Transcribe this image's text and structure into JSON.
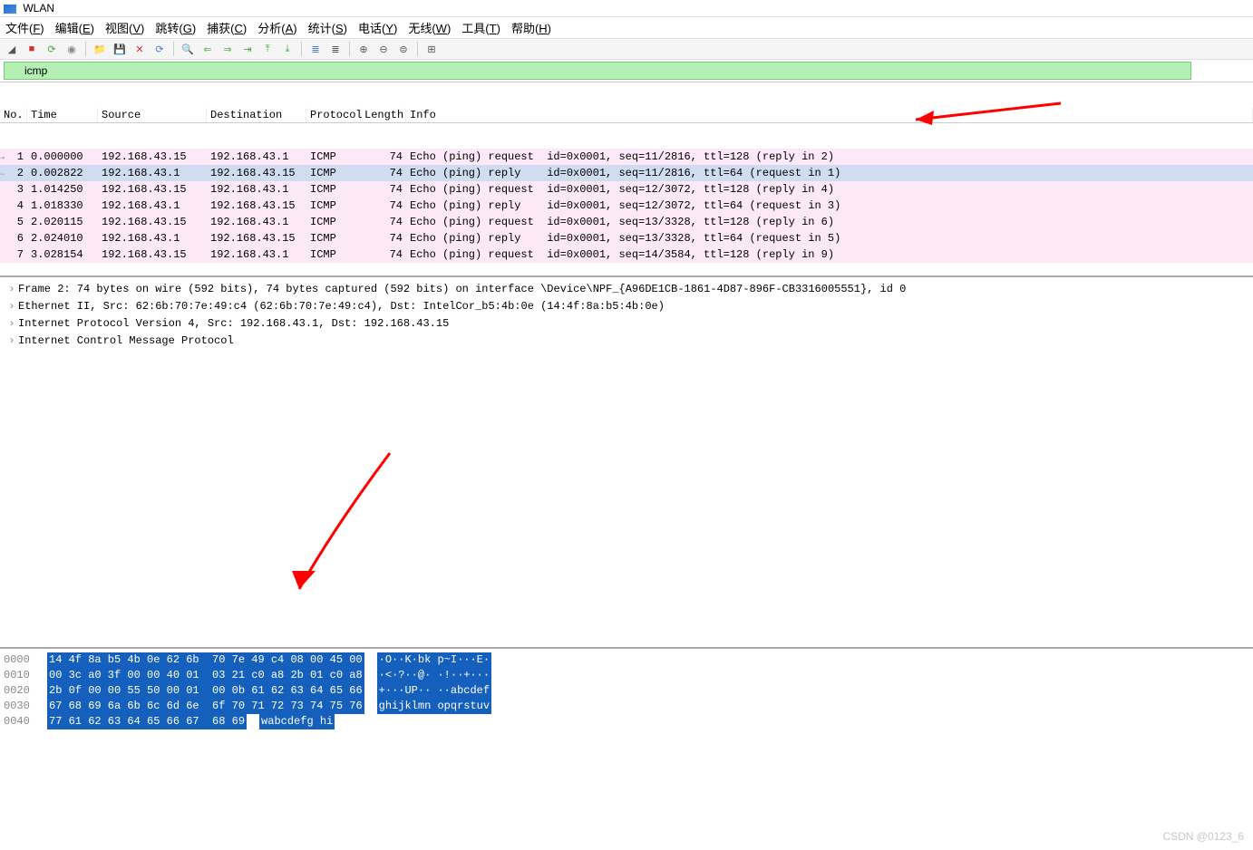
{
  "window_title": "WLAN",
  "menu": [
    "文件(F)",
    "编辑(E)",
    "视图(V)",
    "跳转(G)",
    "捕获(C)",
    "分析(A)",
    "统计(S)",
    "电话(Y)",
    "无线(W)",
    "工具(T)",
    "帮助(H)"
  ],
  "filter_value": "icmp",
  "columns": {
    "no": "No.",
    "time": "Time",
    "src": "Source",
    "dst": "Destination",
    "proto": "Protocol",
    "len": "Length",
    "info": "Info"
  },
  "packets": [
    {
      "no": "1",
      "time": "0.000000",
      "src": "192.168.43.15",
      "dst": "192.168.43.1",
      "proto": "ICMP",
      "len": "74",
      "info": "Echo (ping) request  id=0x0001, seq=11/2816, ttl=128 (reply in 2)",
      "cls": "pink",
      "arrow": "→"
    },
    {
      "no": "2",
      "time": "0.002822",
      "src": "192.168.43.1",
      "dst": "192.168.43.15",
      "proto": "ICMP",
      "len": "74",
      "info": "Echo (ping) reply    id=0x0001, seq=11/2816, ttl=64 (request in 1)",
      "cls": "blue-sel",
      "arrow": "←"
    },
    {
      "no": "3",
      "time": "1.014250",
      "src": "192.168.43.15",
      "dst": "192.168.43.1",
      "proto": "ICMP",
      "len": "74",
      "info": "Echo (ping) request  id=0x0001, seq=12/3072, ttl=128 (reply in 4)",
      "cls": "pink",
      "arrow": ""
    },
    {
      "no": "4",
      "time": "1.018330",
      "src": "192.168.43.1",
      "dst": "192.168.43.15",
      "proto": "ICMP",
      "len": "74",
      "info": "Echo (ping) reply    id=0x0001, seq=12/3072, ttl=64 (request in 3)",
      "cls": "pink",
      "arrow": ""
    },
    {
      "no": "5",
      "time": "2.020115",
      "src": "192.168.43.15",
      "dst": "192.168.43.1",
      "proto": "ICMP",
      "len": "74",
      "info": "Echo (ping) request  id=0x0001, seq=13/3328, ttl=128 (reply in 6)",
      "cls": "pink",
      "arrow": ""
    },
    {
      "no": "6",
      "time": "2.024010",
      "src": "192.168.43.1",
      "dst": "192.168.43.15",
      "proto": "ICMP",
      "len": "74",
      "info": "Echo (ping) reply    id=0x0001, seq=13/3328, ttl=64 (request in 5)",
      "cls": "pink",
      "arrow": ""
    },
    {
      "no": "7",
      "time": "3.028154",
      "src": "192.168.43.15",
      "dst": "192.168.43.1",
      "proto": "ICMP",
      "len": "74",
      "info": "Echo (ping) request  id=0x0001, seq=14/3584, ttl=128 (reply in 9)",
      "cls": "pink",
      "arrow": ""
    }
  ],
  "tree": [
    "Frame 2: 74 bytes on wire (592 bits), 74 bytes captured (592 bits) on interface \\Device\\NPF_{A96DE1CB-1861-4D87-896F-CB3316005551}, id 0",
    "Ethernet II, Src: 62:6b:70:7e:49:c4 (62:6b:70:7e:49:c4), Dst: IntelCor_b5:4b:0e (14:4f:8a:b5:4b:0e)",
    "Internet Protocol Version 4, Src: 192.168.43.1, Dst: 192.168.43.15",
    "Internet Control Message Protocol"
  ],
  "hex": [
    {
      "off": "0000",
      "b1": "14 4f 8a b5 4b 0e 62 6b",
      "b2": "70 7e 49 c4 08 00 45 00",
      "asc": "·O··K·bk p~I···E·"
    },
    {
      "off": "0010",
      "b1": "00 3c a0 3f 00 00 40 01",
      "b2": "03 21 c0 a8 2b 01 c0 a8",
      "asc": "·<·?··@· ·!··+···"
    },
    {
      "off": "0020",
      "b1": "2b 0f 00 00 55 50 00 01",
      "b2": "00 0b 61 62 63 64 65 66",
      "asc": "+···UP·· ··abcdef"
    },
    {
      "off": "0030",
      "b1": "67 68 69 6a 6b 6c 6d 6e",
      "b2": "6f 70 71 72 73 74 75 76",
      "asc": "ghijklmn opqrstuv"
    },
    {
      "off": "0040",
      "b1": "77 61 62 63 64 65 66 67",
      "b2": "68 69",
      "asc": "wabcdefg hi"
    }
  ],
  "watermark": "CSDN @0123_6"
}
